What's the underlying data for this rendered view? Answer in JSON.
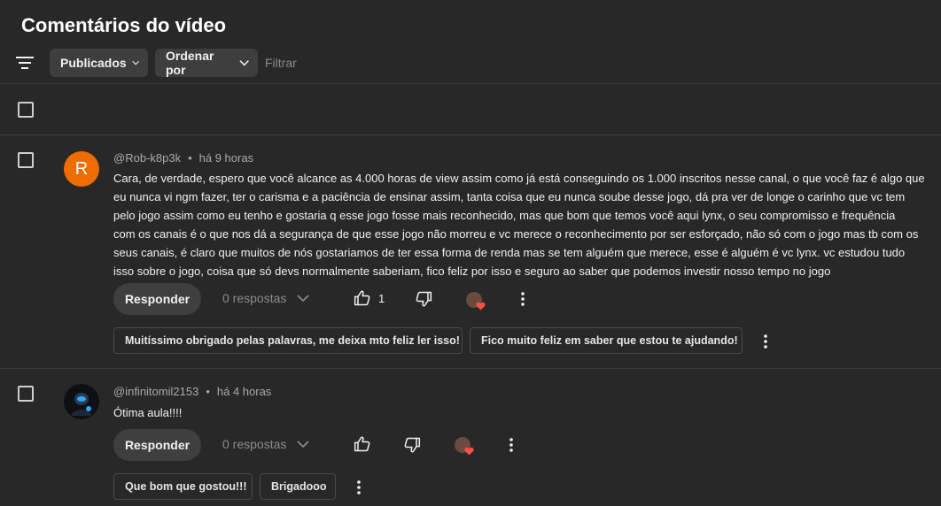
{
  "page": {
    "title": "Comentários do vídeo"
  },
  "toolbar": {
    "published_label": "Publicados",
    "sort_label": "Ordenar por",
    "filter_placeholder": "Filtrar"
  },
  "comments": [
    {
      "avatar_letter": "R",
      "avatar_color": "#ef6c00",
      "author": "@Rob-k8p3k",
      "time": "há 9 horas",
      "lines": [
        "Cara, de verdade, espero que você alcance as 4.000 horas de view assim como já está conseguindo os 1.000 inscritos nesse canal, o que você faz é algo que",
        "eu nunca vi ngm fazer, ter o carisma e a paciência de ensinar assim, tanta coisa que eu nunca soube desse jogo, dá pra ver de longe o carinho que vc tem",
        "pelo jogo assim como eu tenho e gostaria q esse jogo fosse mais reconhecido, mas que bom que temos você aqui lynx, o seu compromisso e frequência",
        "com os canais é o que nos dá a segurança de que esse jogo não morreu e vc merece o reconhecimento por ser esforçado, não só com o jogo mas tb com os",
        "seus canais, é claro que muitos de nós gostariamos de ter essa forma de renda mas se tem alguém que merece, esse é alguém é vc lynx. vc estudou tudo",
        "isso sobre o jogo, coisa que só devs normalmente saberiam, fico feliz por isso e seguro ao saber que podemos investir nosso tempo no jogo"
      ],
      "reply_label": "Responder",
      "replies_label": "0 respostas",
      "like_count": "1",
      "suggestions": [
        "Muitíssimo obrigado pelas palavras, me deixa mto feliz ler isso!",
        "Fico muito feliz em saber que estou te ajudando!"
      ]
    },
    {
      "avatar_color": "#101418",
      "author": "@infinitomil2153",
      "time": "há 4 horas",
      "lines": [
        "Ótima aula!!!!"
      ],
      "reply_label": "Responder",
      "replies_label": "0 respostas",
      "suggestions": [
        "Que bom que gostou!!!",
        "Brigadooo"
      ]
    }
  ],
  "meta_separator": "•",
  "colors": {
    "background": "#282828",
    "chip": "#3e3e3e",
    "heart": "#ff4e45"
  },
  "icons": [
    "filter-icon",
    "chevron-down-icon",
    "thumb-up-icon",
    "thumb-down-icon",
    "heart-icon",
    "more-vert-icon"
  ]
}
